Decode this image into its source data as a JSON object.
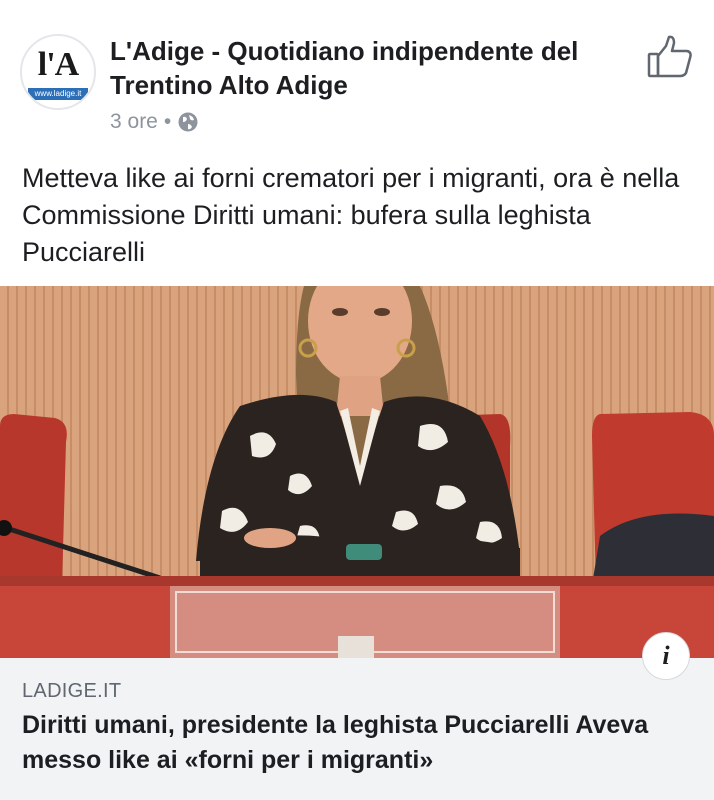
{
  "post": {
    "page_name": "L'Adige - Quotidiano indipendente del Trentino Alto Adige",
    "time": "3 ore",
    "separator": "•",
    "privacy_icon": "globe-icon",
    "text": "Metteva like ai forni crematori per i migranti, ora è nella Commissione Diritti umani: bufera sulla leghista Pucciarelli"
  },
  "avatar": {
    "logo_text": "l'A",
    "logo_url": "www.ladige.it"
  },
  "actions": {
    "like_icon": "thumbs-up-icon"
  },
  "link_preview": {
    "info_icon": "i",
    "domain": "LADIGE.IT",
    "title": "Diritti umani, presidente la leghista Pucciarelli Aveva messo like ai «forni per i migranti»"
  },
  "colors": {
    "text": "#1c1e21",
    "secondary_text": "#8d949e",
    "card_background": "#f2f3f5"
  }
}
